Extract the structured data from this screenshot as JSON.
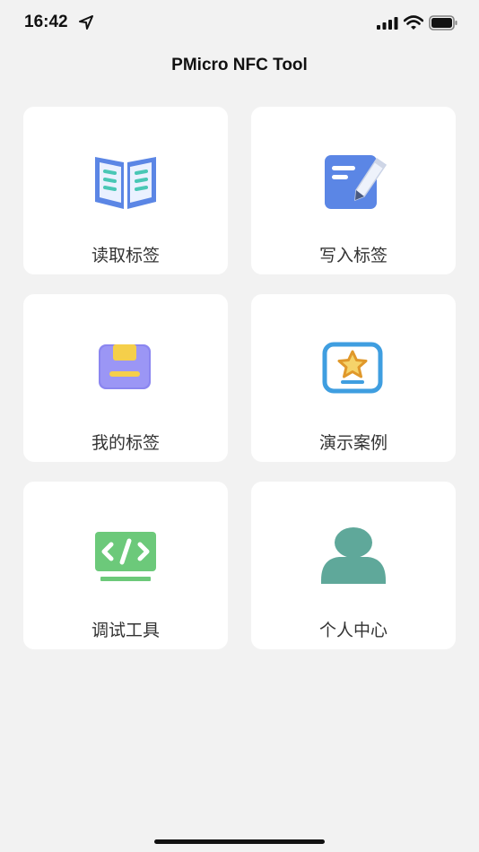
{
  "status_bar": {
    "time": "16:42",
    "icons": [
      "location-arrow-icon",
      "cellular-signal-icon",
      "wifi-icon",
      "battery-icon"
    ]
  },
  "header": {
    "title": "PMicro NFC Tool"
  },
  "menu": {
    "items": [
      {
        "label": "读取标签",
        "icon": "open-book-icon",
        "color": "#5b86e5"
      },
      {
        "label": "写入标签",
        "icon": "edit-note-icon",
        "color": "#5b86e5"
      },
      {
        "label": "我的标签",
        "icon": "storage-box-icon",
        "color": "#8b86f0"
      },
      {
        "label": "演示案例",
        "icon": "star-frame-icon",
        "color": "#3f9ee0"
      },
      {
        "label": "调试工具",
        "icon": "code-icon",
        "color": "#6cc97a"
      },
      {
        "label": "个人中心",
        "icon": "user-icon",
        "color": "#5fa89a"
      }
    ]
  }
}
